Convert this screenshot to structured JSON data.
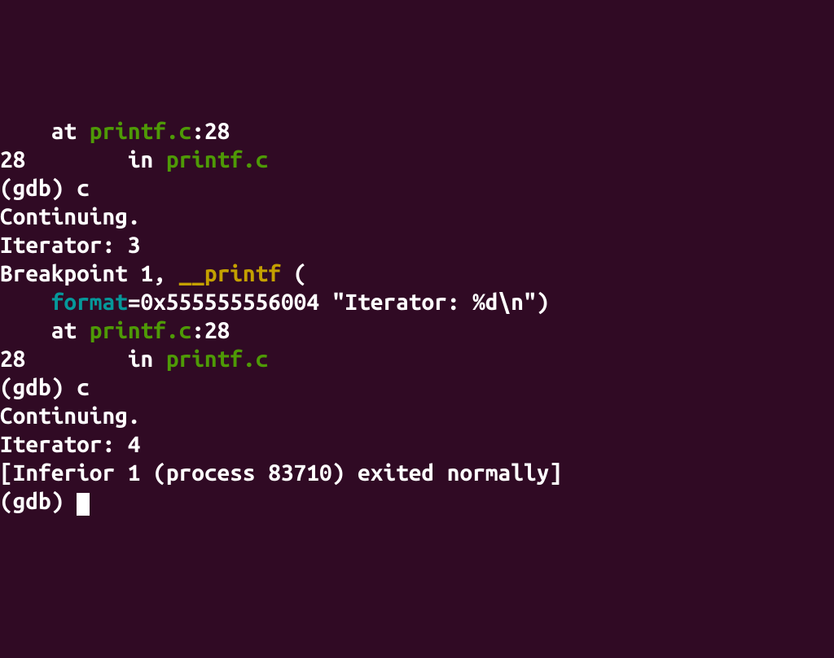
{
  "lines": {
    "l1_indent": "    ",
    "l1_at": "at ",
    "l1_file": "printf.c",
    "l1_colon": ":",
    "l1_line": "28",
    "l2_num": "28",
    "l2_pad": "        ",
    "l2_in": "in ",
    "l2_file": "printf.c",
    "l3_prompt": "(gdb) ",
    "l3_cmd": "c",
    "l4": "Continuing.",
    "l5": "Iterator: 3",
    "l6": "",
    "l7_bp": "Breakpoint 1, ",
    "l7_fn": "__printf",
    "l7_rest": " (",
    "l8_indent": "    ",
    "l8_param": "format",
    "l8_rest": "=0x555555556004 \"Iterator: %d\\n\")",
    "l9_indent": "    ",
    "l9_at": "at ",
    "l9_file": "printf.c",
    "l9_colon": ":",
    "l9_line": "28",
    "l10_num": "28",
    "l10_pad": "        ",
    "l10_in": "in ",
    "l10_file": "printf.c",
    "l11_prompt": "(gdb) ",
    "l11_cmd": "c",
    "l12": "Continuing.",
    "l13": "Iterator: 4",
    "l14": "[Inferior 1 (process 83710) exited normally]",
    "l15_prompt": "(gdb) "
  }
}
